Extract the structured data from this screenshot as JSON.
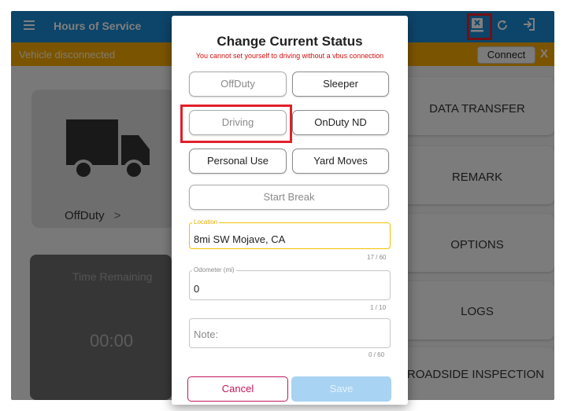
{
  "appbar": {
    "title": "Hours of Service",
    "color": "#1a88d2",
    "icons": [
      "menu-icon",
      "transfer-icon",
      "refresh-icon",
      "logout-icon"
    ]
  },
  "banner": {
    "text": "Vehicle disconnected",
    "connect_label": "Connect",
    "close_label": "X",
    "color": "#f6a800"
  },
  "status_card": {
    "label": "OffDuty",
    "chevron": ">"
  },
  "time_card": {
    "label": "Time Remaining",
    "value": "00:00"
  },
  "side_buttons": [
    {
      "label": "DATA TRANSFER"
    },
    {
      "label": "REMARK"
    },
    {
      "label": "OPTIONS"
    },
    {
      "label": "LOGS"
    },
    {
      "label": "ROADSIDE INSPECTION"
    }
  ],
  "dialog": {
    "title": "Change Current Status",
    "warning": "You cannot set yourself to driving without a vbus connection",
    "statuses": {
      "offduty": "OffDuty",
      "sleeper": "Sleeper",
      "driving": "Driving",
      "onduty_nd": "OnDuty ND",
      "personal_use": "Personal Use",
      "yard_moves": "Yard Moves",
      "start_break": "Start Break"
    },
    "location": {
      "label": "Location",
      "value": "8mi SW Mojave, CA",
      "count": "17 / 60"
    },
    "odometer": {
      "label": "Odometer (mi)",
      "value": "0",
      "count": "1 / 10"
    },
    "note": {
      "placeholder": "Note:",
      "count": "0 / 60"
    },
    "cancel_label": "Cancel",
    "save_label": "Save"
  },
  "colors": {
    "highlight": "#e0202a",
    "location_focus": "#f2c200",
    "cancel": "#c2185b",
    "save_disabled": "#a9d3f2",
    "warning_text": "#d01010"
  }
}
